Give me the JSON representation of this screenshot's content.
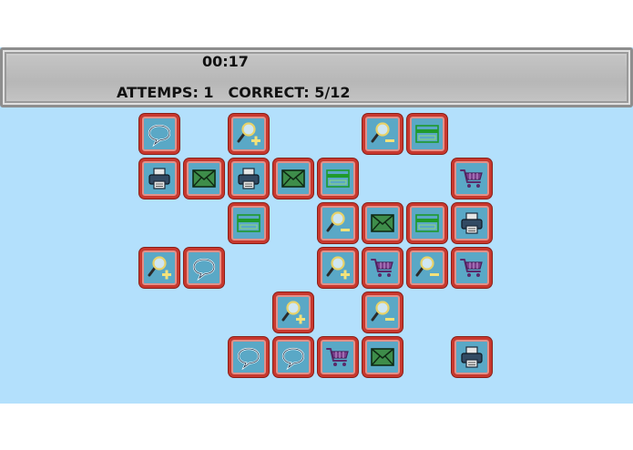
{
  "hud": {
    "timer": "00:17",
    "attempts": "ATTEMPS: 1",
    "correct": "CORRECT: 5/12"
  },
  "board": {
    "tiles": [
      {
        "row": 0,
        "col": 0,
        "icon": "speech-bubble-icon"
      },
      {
        "row": 0,
        "col": 2,
        "icon": "zoom-in-icon"
      },
      {
        "row": 0,
        "col": 5,
        "icon": "zoom-out-icon"
      },
      {
        "row": 0,
        "col": 6,
        "icon": "credit-card-icon"
      },
      {
        "row": 1,
        "col": 0,
        "icon": "printer-icon"
      },
      {
        "row": 1,
        "col": 1,
        "icon": "envelope-icon"
      },
      {
        "row": 1,
        "col": 2,
        "icon": "printer-icon"
      },
      {
        "row": 1,
        "col": 3,
        "icon": "envelope-icon"
      },
      {
        "row": 1,
        "col": 4,
        "icon": "credit-card-icon"
      },
      {
        "row": 1,
        "col": 7,
        "icon": "shopping-cart-icon"
      },
      {
        "row": 2,
        "col": 2,
        "icon": "credit-card-icon"
      },
      {
        "row": 2,
        "col": 4,
        "icon": "zoom-out-icon"
      },
      {
        "row": 2,
        "col": 5,
        "icon": "envelope-icon"
      },
      {
        "row": 2,
        "col": 6,
        "icon": "credit-card-icon"
      },
      {
        "row": 2,
        "col": 7,
        "icon": "printer-icon"
      },
      {
        "row": 3,
        "col": 0,
        "icon": "zoom-in-icon"
      },
      {
        "row": 3,
        "col": 1,
        "icon": "speech-bubble-icon"
      },
      {
        "row": 3,
        "col": 4,
        "icon": "zoom-in-icon"
      },
      {
        "row": 3,
        "col": 5,
        "icon": "shopping-cart-icon"
      },
      {
        "row": 3,
        "col": 6,
        "icon": "zoom-out-icon"
      },
      {
        "row": 3,
        "col": 7,
        "icon": "shopping-cart-icon"
      },
      {
        "row": 4,
        "col": 3,
        "icon": "zoom-in-icon"
      },
      {
        "row": 4,
        "col": 5,
        "icon": "zoom-out-icon"
      },
      {
        "row": 5,
        "col": 2,
        "icon": "speech-bubble-icon"
      },
      {
        "row": 5,
        "col": 3,
        "icon": "speech-bubble-icon"
      },
      {
        "row": 5,
        "col": 4,
        "icon": "shopping-cart-icon"
      },
      {
        "row": 5,
        "col": 5,
        "icon": "envelope-icon"
      },
      {
        "row": 5,
        "col": 7,
        "icon": "printer-icon"
      }
    ]
  },
  "colors": {
    "background": "#b3e0fc",
    "tile_fill": "#5aa8c6",
    "tile_border": "#c8382e"
  }
}
